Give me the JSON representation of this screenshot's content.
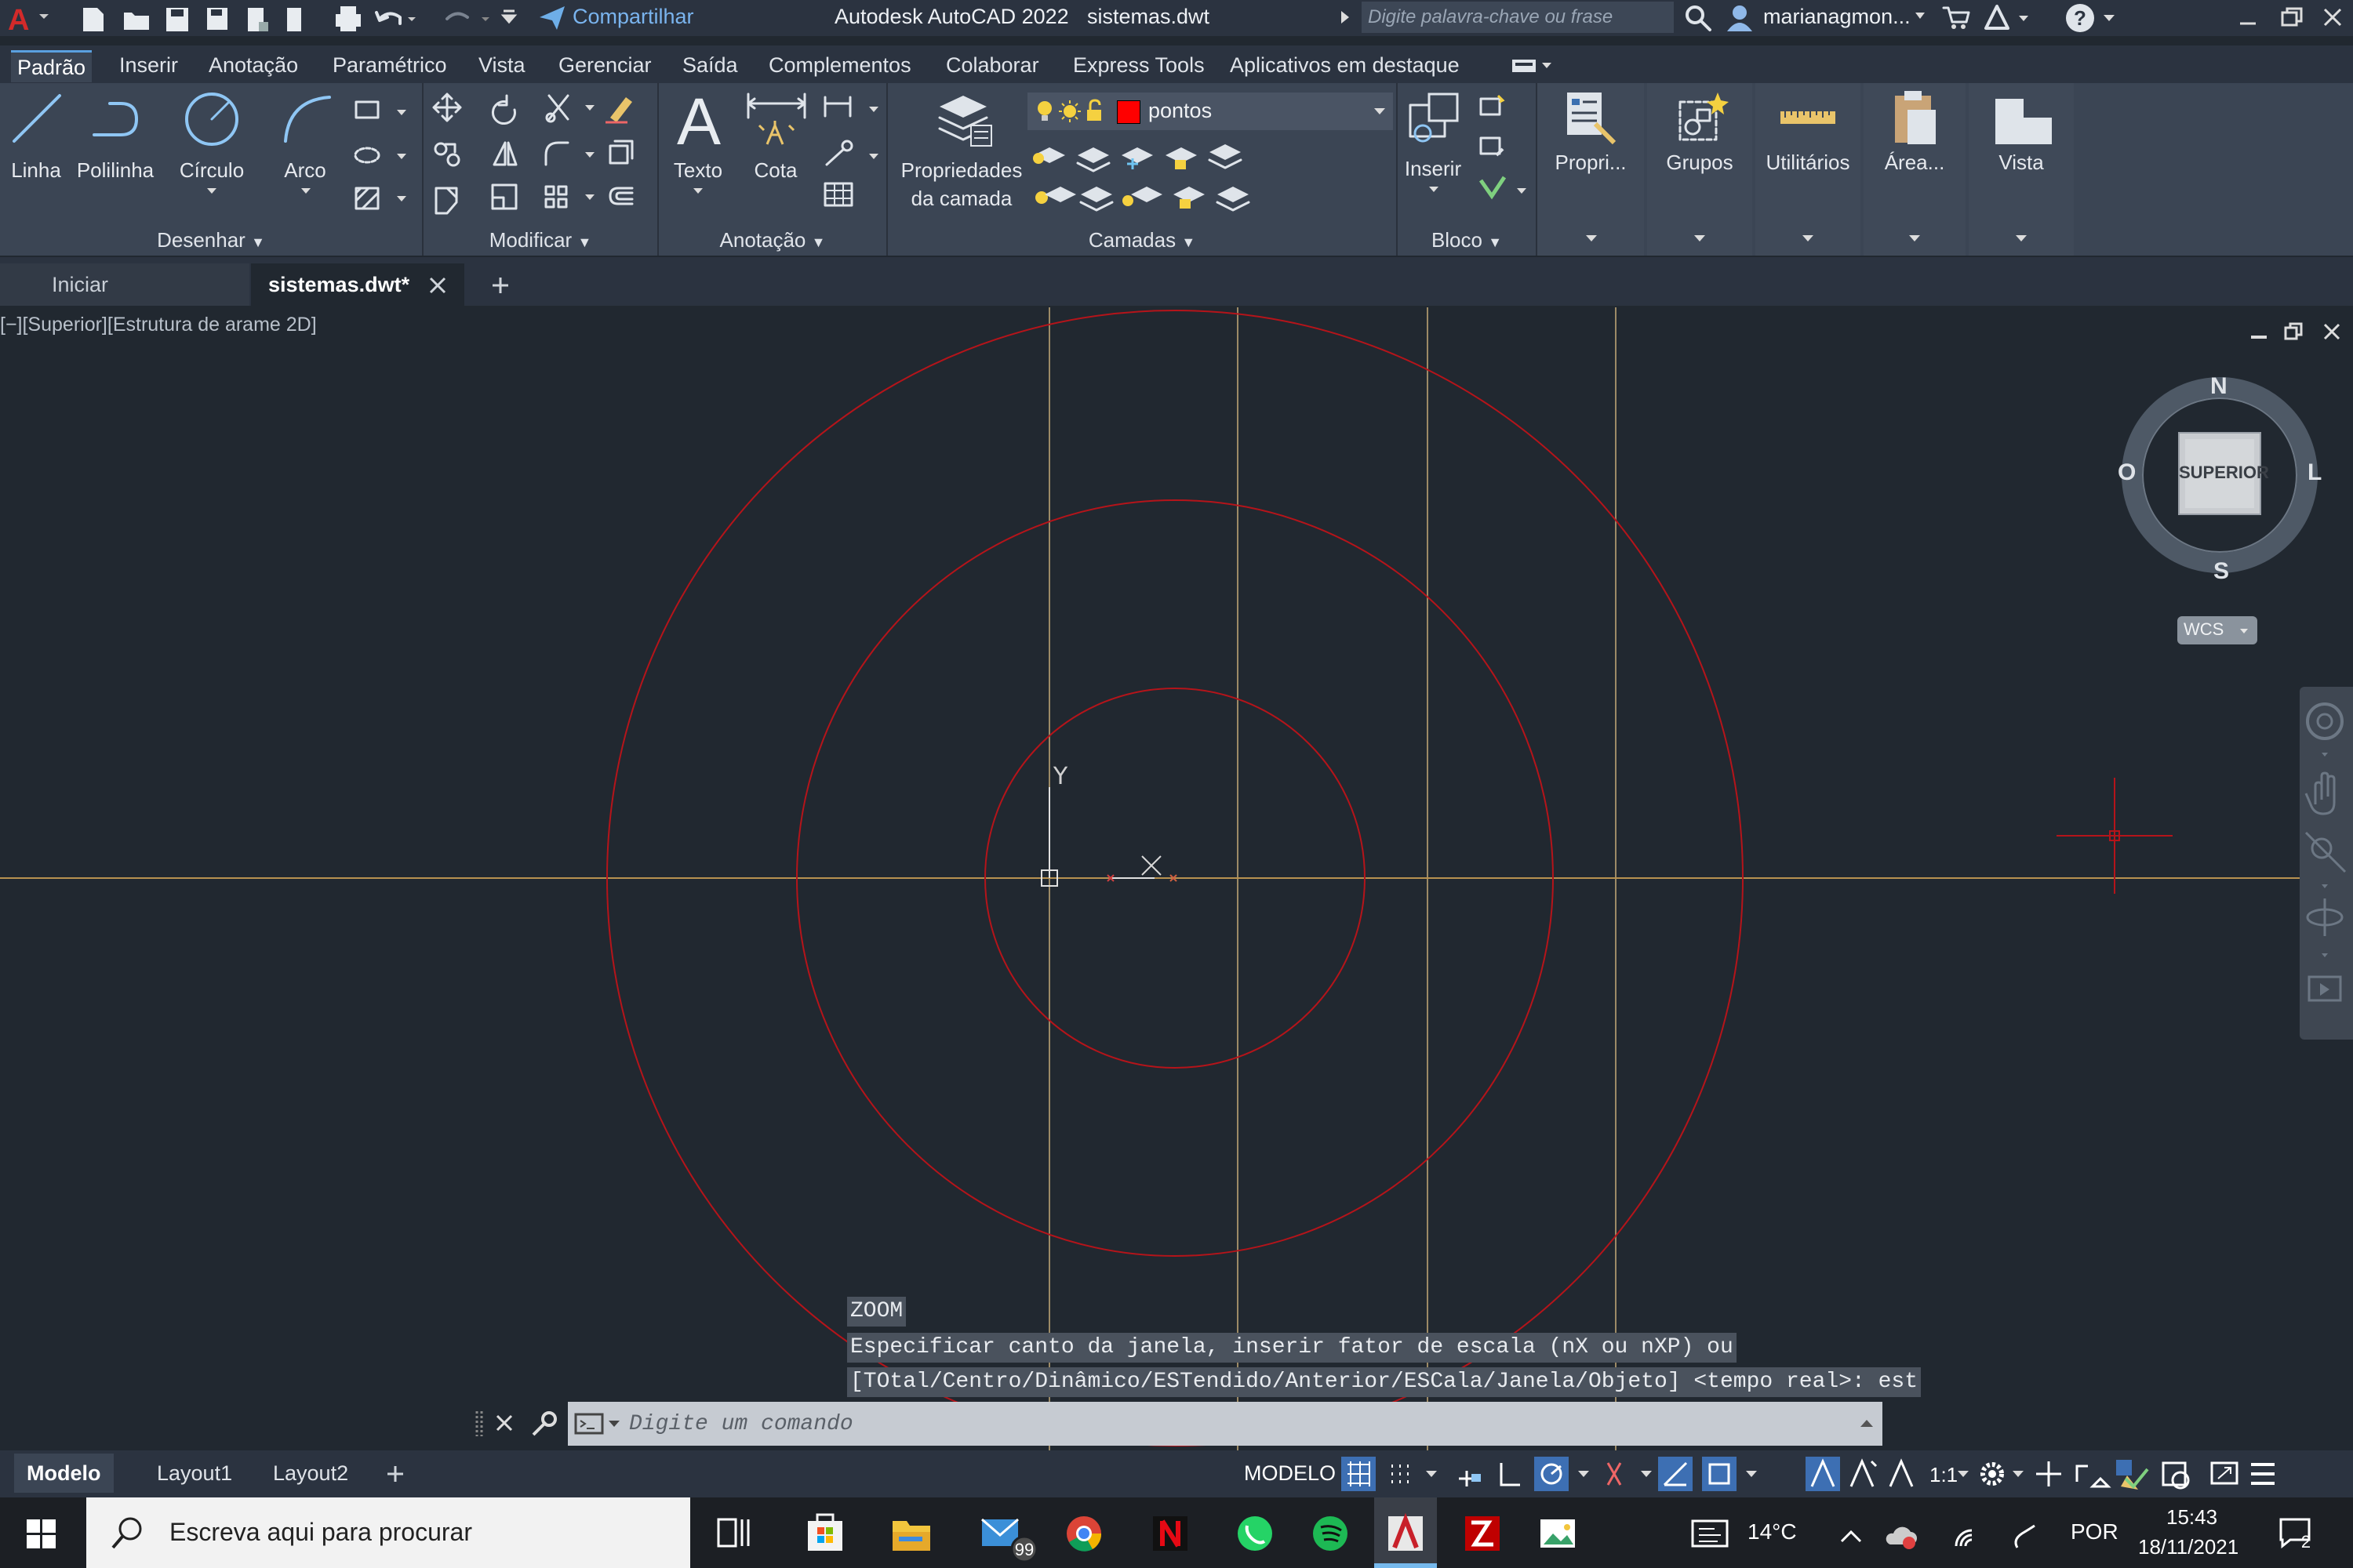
{
  "titlebar": {
    "share_label": "Compartilhar",
    "app_title": "Autodesk AutoCAD 2022",
    "file_name": "sistemas.dwt",
    "search_placeholder": "Digite palavra-chave ou frase",
    "user_name": "marianagmon...",
    "help_label": "?"
  },
  "ribbon_tabs": [
    {
      "label": "Padrão",
      "active": true
    },
    {
      "label": "Inserir"
    },
    {
      "label": "Anotação"
    },
    {
      "label": "Paramétrico"
    },
    {
      "label": "Vista"
    },
    {
      "label": "Gerenciar"
    },
    {
      "label": "Saída"
    },
    {
      "label": "Complementos"
    },
    {
      "label": "Colaborar"
    },
    {
      "label": "Express Tools"
    },
    {
      "label": "Aplicativos em destaque"
    }
  ],
  "ribbon": {
    "desenhar": {
      "label": "Desenhar",
      "linha": "Linha",
      "polilinha": "Polilinha",
      "circulo": "Círculo",
      "arco": "Arco"
    },
    "modificar": {
      "label": "Modificar"
    },
    "anotacao": {
      "label": "Anotação",
      "texto": "Texto",
      "cota": "Cota",
      "texto_glyph": "A"
    },
    "camadas": {
      "label": "Camadas",
      "propriedades_1": "Propriedades",
      "propriedades_2": "da camada",
      "current_layer": "pontos",
      "layer_color": "#ff0000"
    },
    "bloco": {
      "label": "Bloco",
      "inserir": "Inserir"
    },
    "propri": "Propri...",
    "grupos": "Grupos",
    "utilitarios": "Utilitários",
    "area": "Área...",
    "vista": "Vista"
  },
  "doc_tabs": {
    "start": "Iniciar",
    "active": "sistemas.dwt*"
  },
  "viewport": {
    "label": "[−][Superior][Estrutura de arame 2D]"
  },
  "viewcube": {
    "north": "N",
    "south": "S",
    "east": "L",
    "west": "O",
    "face": "SUPERIOR",
    "wcs": "WCS"
  },
  "ucs": {
    "y_label": "Y"
  },
  "command": {
    "history": [
      "ZOOM",
      "Especificar canto da janela, inserir fator de escala (nX ou nXP) ou",
      "[TOtal/Centro/Dinâmico/ESTendido/Anterior/ESCala/Janela/Objeto] <tempo real>: est"
    ],
    "placeholder": "Digite um comando"
  },
  "layout_tabs": [
    "Modelo",
    "Layout1",
    "Layout2"
  ],
  "status": {
    "mode": "MODELO",
    "scale": "1:1"
  },
  "taskbar": {
    "search_placeholder": "Escreva aqui para procurar",
    "mail_badge": "99",
    "weather": "14°C",
    "language": "POR",
    "time": "15:43",
    "date": "18/11/2021",
    "notification_count": "2"
  },
  "colors": {
    "circle": "#b5141a",
    "guide": "#9c8a66",
    "axis": "#b89250",
    "accent": "#5aa0e0"
  }
}
